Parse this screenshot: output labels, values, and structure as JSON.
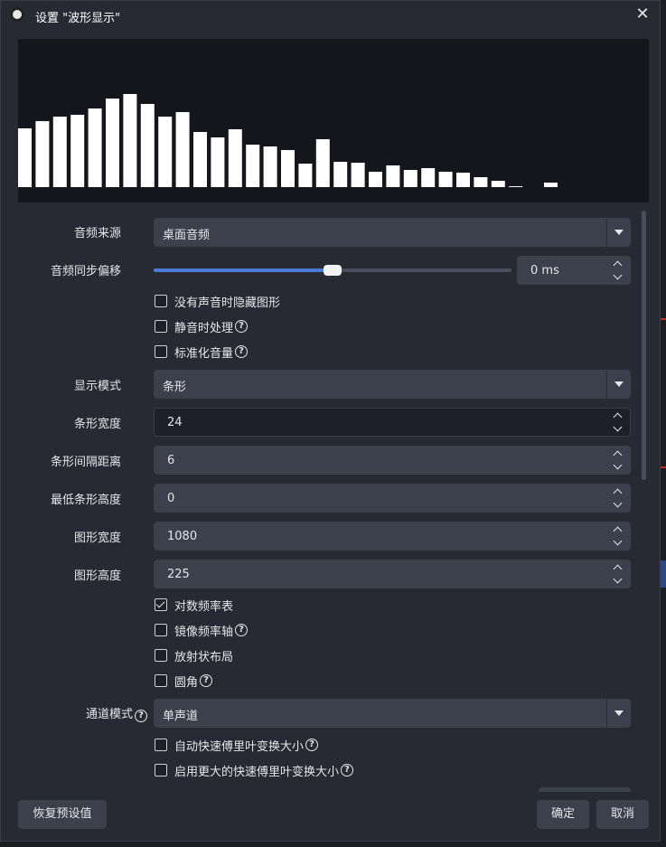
{
  "window": {
    "title": "设置 \"波形显示\""
  },
  "preview": {
    "bars": [
      65,
      73,
      78,
      80,
      87,
      98,
      103,
      92,
      78,
      83,
      61,
      55,
      64,
      47,
      45,
      41,
      26,
      53,
      28,
      27,
      17,
      24,
      19,
      21,
      17,
      16,
      11,
      7,
      1,
      0,
      5
    ],
    "bar_color": "#ffffff",
    "background": "#14161b"
  },
  "fields": {
    "audio_source": {
      "label": "音频来源",
      "value": "桌面音频"
    },
    "sync_offset": {
      "label": "音频同步偏移",
      "value": "0 ms",
      "slider_fraction": 0.5
    },
    "hide_on_silence": {
      "label": "没有声音时隐藏图形",
      "checked": false
    },
    "mute_handling": {
      "label": "静音时处理",
      "checked": false
    },
    "normalize_volume": {
      "label": "标准化音量",
      "checked": false
    },
    "display_mode": {
      "label": "显示模式",
      "value": "条形"
    },
    "bar_width": {
      "label": "条形宽度",
      "value": "24"
    },
    "bar_gap": {
      "label": "条形间隔距离",
      "value": "6"
    },
    "min_bar_height": {
      "label": "最低条形高度",
      "value": "0"
    },
    "graph_width": {
      "label": "图形宽度",
      "value": "1080"
    },
    "graph_height": {
      "label": "图形高度",
      "value": "225"
    },
    "log_frequency": {
      "label": "对数频率表",
      "checked": true
    },
    "mirror_freq_axis": {
      "label": "镜像频率轴",
      "checked": false
    },
    "radial_layout": {
      "label": "放射状布局",
      "checked": false
    },
    "rounded_corners": {
      "label": "圆角",
      "checked": false
    },
    "channel_mode": {
      "label": "通道模式",
      "value": "单声道"
    },
    "auto_fft_size": {
      "label": "自动快速傅里叶变换大小",
      "checked": false
    },
    "larger_fft": {
      "label": "启用更大的快速傅里叶变换大小",
      "checked": false
    }
  },
  "buttons": {
    "restore_defaults": "恢复预设值",
    "ok": "确定",
    "cancel": "取消"
  },
  "icons": {
    "help": "?",
    "close": "✕"
  }
}
